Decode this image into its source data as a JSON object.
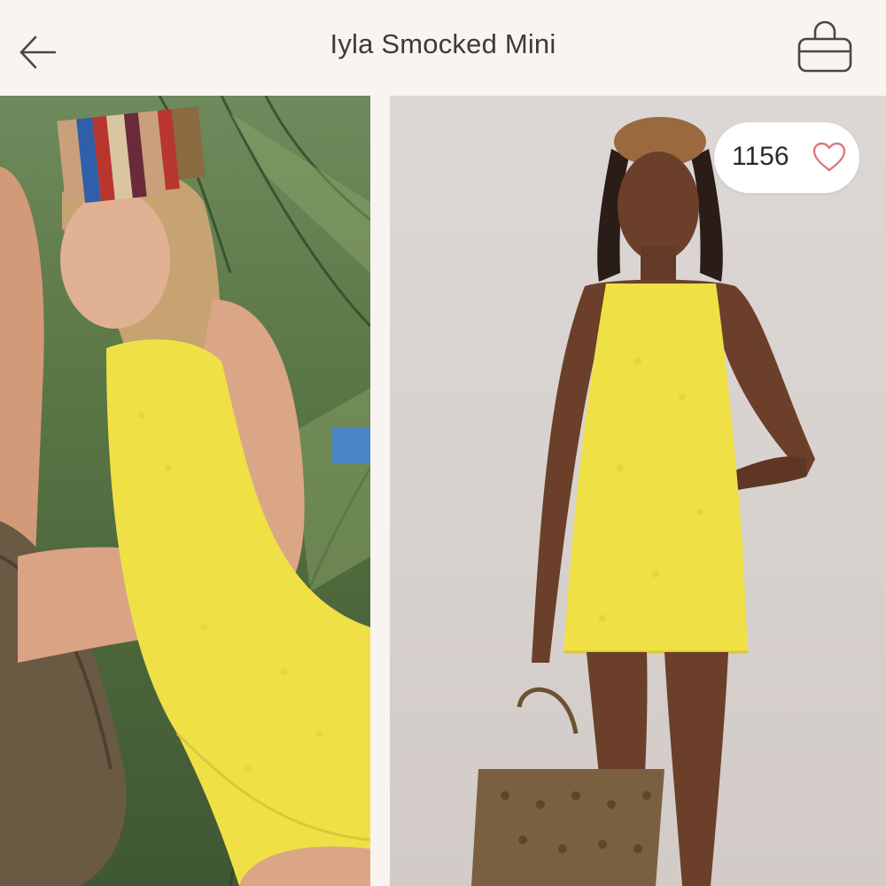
{
  "header": {
    "title": "Iyla Smocked Mini",
    "back_icon": "arrow-left-icon",
    "bag_icon": "shopping-bag-icon"
  },
  "likes": {
    "count": "1156",
    "icon": "heart-outline-icon",
    "icon_color": "#e0787a"
  },
  "photos": [
    {
      "name": "lifestyle-photo",
      "subject": "model in yellow smocked mini dress with striped headscarf among palm leaves"
    },
    {
      "name": "studio-photo",
      "subject": "model in yellow smocked mini dress holding woven tote bag"
    }
  ],
  "colors": {
    "background": "#f8f4ef",
    "dress": "#efe046",
    "text": "#3e3a37"
  }
}
